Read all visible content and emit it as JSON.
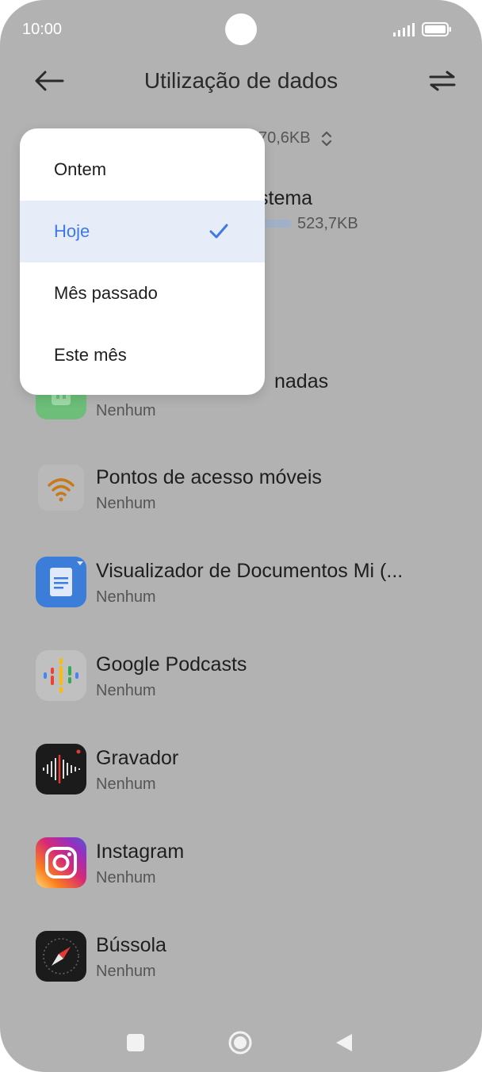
{
  "status_bar": {
    "time": "10:00"
  },
  "header": {
    "title": "Utilização de dados",
    "back_icon": "arrow-left-icon",
    "sort_icon": "swap-arrows-icon"
  },
  "summary": {
    "value": "70,6KB",
    "chevron_icon": "chevron-up-down-icon"
  },
  "system_item": {
    "name_fragment": "stema",
    "size": "523,7KB",
    "bar_color": "#9fb0c8"
  },
  "apps": [
    {
      "name": "nadas",
      "usage": "Nenhum",
      "icon": "green-app-icon",
      "color": "#6cbe78"
    },
    {
      "name": "Pontos de acesso móveis",
      "usage": "Nenhum",
      "icon": "wifi-hotspot-icon",
      "color": "#c7791b"
    },
    {
      "name": "Visualizador de Documentos Mi (...",
      "usage": "Nenhum",
      "icon": "document-viewer-icon",
      "color": "#3b7dd8"
    },
    {
      "name": "Google Podcasts",
      "usage": "Nenhum",
      "icon": "podcasts-icon",
      "color": "#ffffff"
    },
    {
      "name": "Gravador",
      "usage": "Nenhum",
      "icon": "recorder-icon",
      "color": "#1b1b1b"
    },
    {
      "name": "Instagram",
      "usage": "Nenhum",
      "icon": "instagram-icon",
      "color": "#d62976"
    },
    {
      "name": "Bússola",
      "usage": "Nenhum",
      "icon": "compass-icon",
      "color": "#1b1b1b"
    }
  ],
  "dropdown": {
    "options": [
      "Ontem",
      "Hoje",
      "Mês passado",
      "Este mês"
    ],
    "selected": "Hoje",
    "accent_color": "#3f79e6"
  },
  "nav_bar": {
    "recents_icon": "square-icon",
    "home_icon": "circle-home-icon",
    "back_icon": "triangle-back-icon"
  }
}
